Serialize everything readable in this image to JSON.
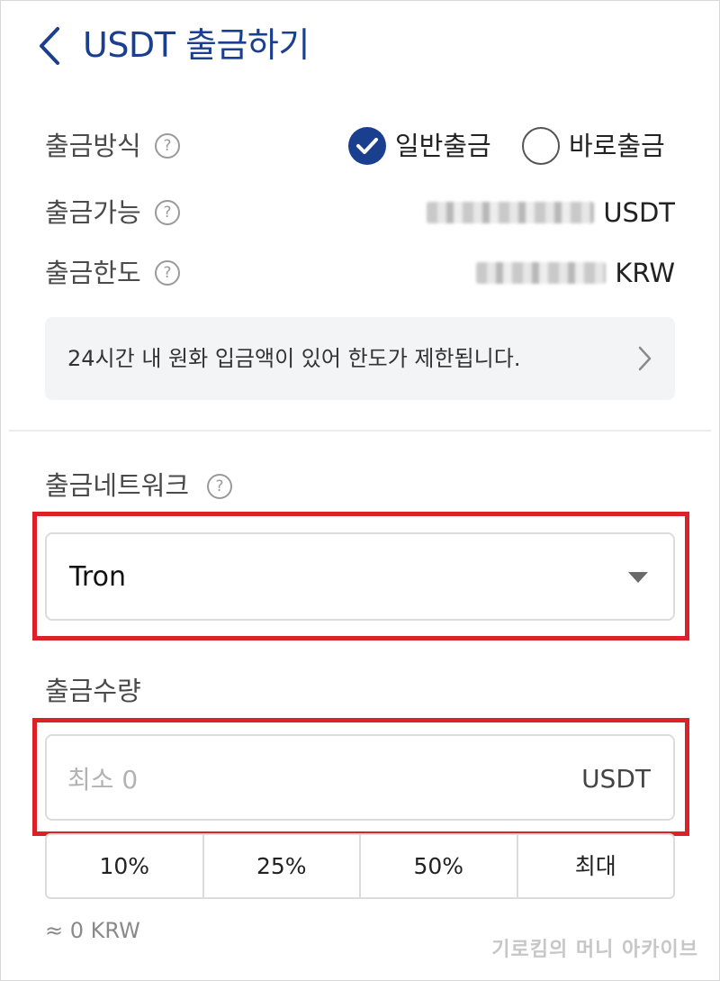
{
  "header": {
    "title": "USDT 출금하기",
    "back_icon": "chevron-left-icon"
  },
  "colors": {
    "brand": "#1a3f8f",
    "highlight": "#dd2128"
  },
  "method": {
    "label": "출금방식",
    "options": [
      {
        "label": "일반출금",
        "selected": true
      },
      {
        "label": "바로출금",
        "selected": false
      }
    ]
  },
  "available": {
    "label": "출금가능",
    "unit": "USDT"
  },
  "limit": {
    "label": "출금한도",
    "unit": "KRW"
  },
  "help_icon": "?",
  "notice": {
    "text": "24시간 내 원화 입금액이 있어 한도가 제한됩니다."
  },
  "network": {
    "label": "출금네트워크",
    "selected": "Tron"
  },
  "amount": {
    "label": "출금수량",
    "placeholder": "최소 0",
    "unit": "USDT",
    "quick_buttons": [
      "10%",
      "25%",
      "50%",
      "최대"
    ],
    "krw_estimate": "≈ 0 KRW"
  },
  "watermark": "기로킴의 머니 아카이브"
}
